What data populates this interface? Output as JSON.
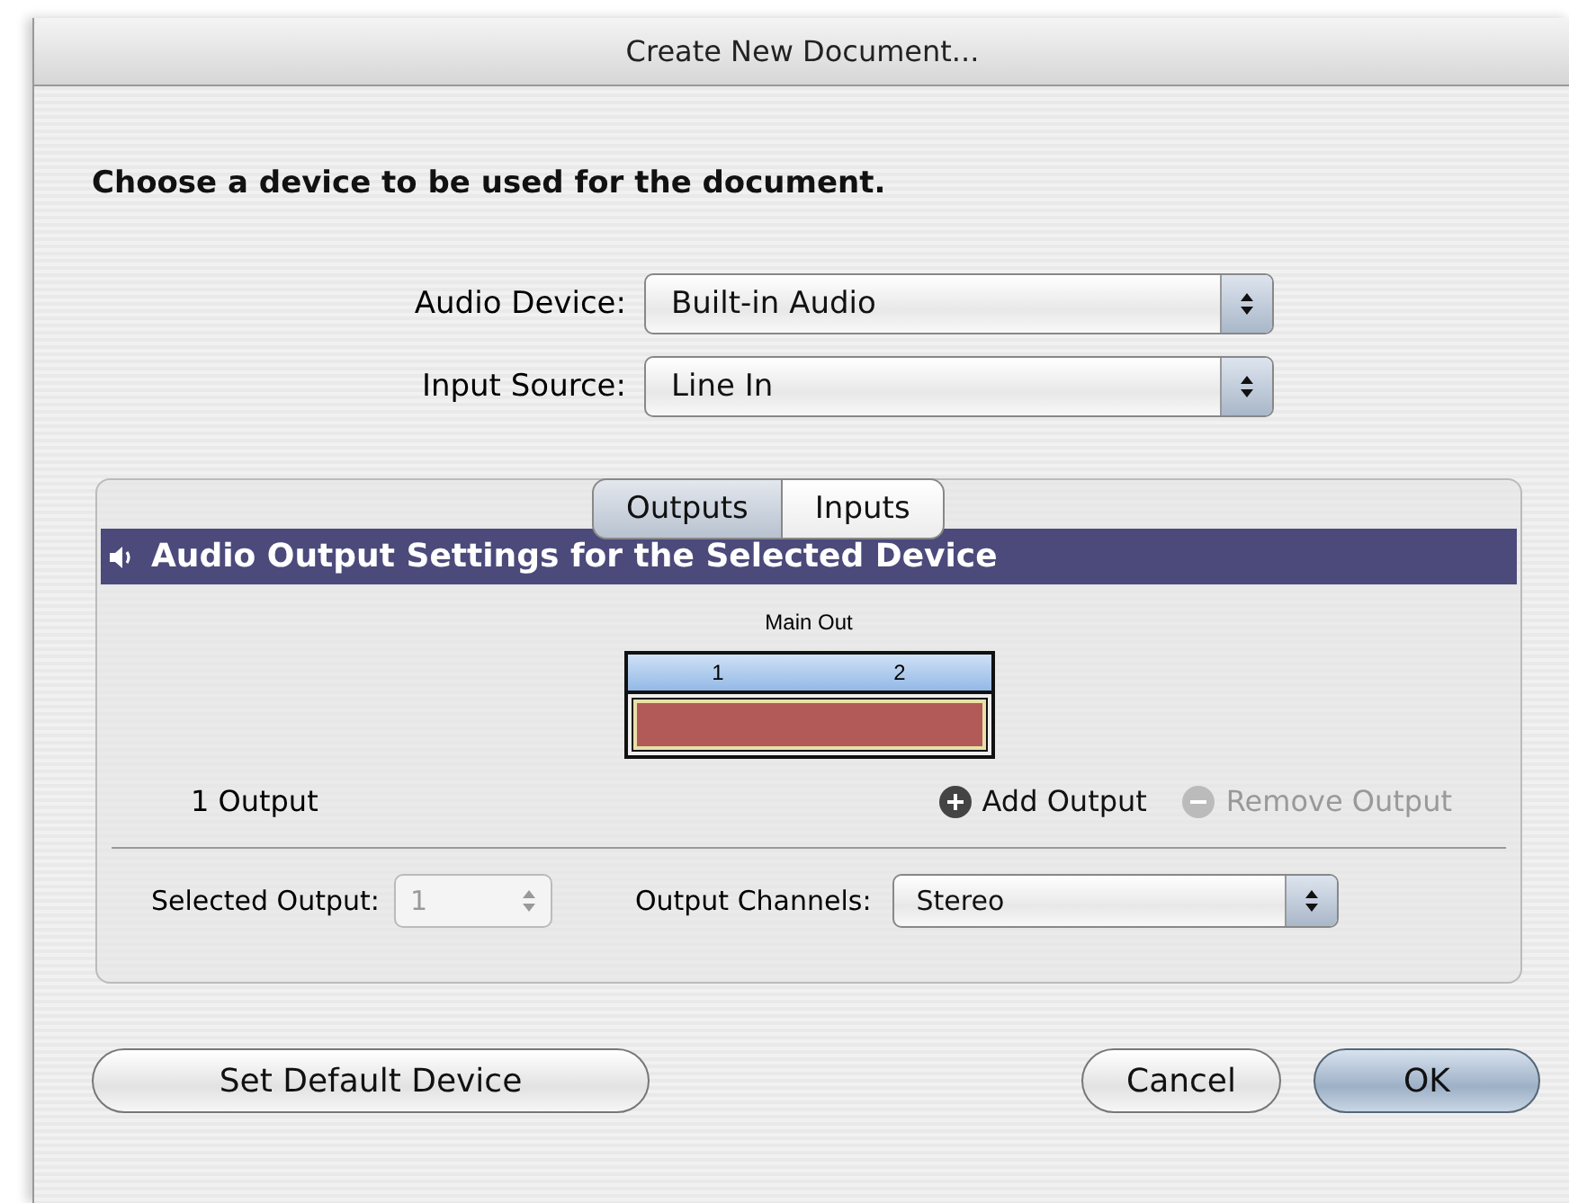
{
  "window": {
    "title": "Create New Document..."
  },
  "heading": "Choose a device to be used for the document.",
  "popups": [
    {
      "label": "Audio Device:",
      "value": "Built-in Audio"
    },
    {
      "label": "Input Source:",
      "value": "Line In"
    }
  ],
  "tabs": [
    {
      "label": "Outputs",
      "selected": true
    },
    {
      "label": "Inputs",
      "selected": false
    }
  ],
  "section_header": "Audio Output Settings for the Selected Device",
  "output_map": {
    "title": "Main Out",
    "channels": [
      "1",
      "2"
    ]
  },
  "output_count": "1 Output",
  "actions": [
    {
      "kind": "add",
      "label": "Add Output",
      "disabled": false
    },
    {
      "kind": "remove",
      "label": "Remove Output",
      "disabled": true
    }
  ],
  "selected_output": {
    "label": "Selected Output:",
    "value": "1",
    "disabled": true
  },
  "output_channels": {
    "label": "Output Channels:",
    "value": "Stereo"
  },
  "buttons": [
    {
      "label": "Set Default Device",
      "default": false,
      "kind": "left"
    },
    {
      "label": "Cancel",
      "default": false,
      "kind": "right"
    },
    {
      "label": "OK",
      "default": true,
      "kind": "right"
    }
  ]
}
